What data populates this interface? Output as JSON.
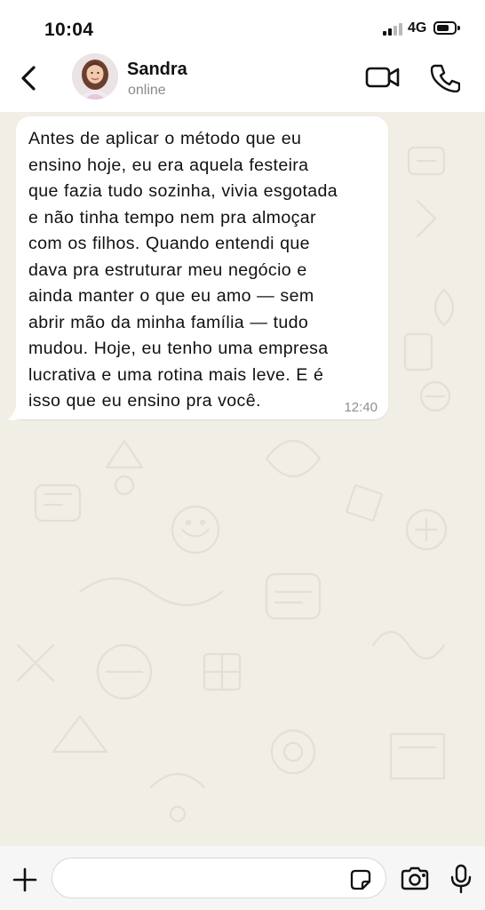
{
  "status_bar": {
    "time": "10:04",
    "network": "4G",
    "signal_icon": "signal-bars-icon",
    "battery_icon": "battery-icon"
  },
  "header": {
    "back_icon": "chevron-left-icon",
    "contact_name": "Sandra",
    "contact_status": "online",
    "video_call_icon": "video-camera-icon",
    "voice_call_icon": "phone-icon"
  },
  "messages": [
    {
      "direction": "incoming",
      "text": "Antes de aplicar o método que eu\nensino hoje, eu era aquela festeira\nque fazia tudo sozinha, vivia esgotada\ne não tinha tempo nem pra almoçar\ncom os filhos. Quando entendi que\ndava pra estruturar meu negócio e\nainda manter o que eu amo — sem\nabrir mão da minha família — tudo\nmudou. Hoje, eu tenho uma empresa\nlucrativa e uma rotina mais leve. E é\nisso que eu ensino pra você.",
      "time": "12:40"
    }
  ],
  "input_bar": {
    "text_value": "",
    "plus_icon": "plus-icon",
    "sticker_icon": "sticker-icon",
    "camera_icon": "camera-icon",
    "mic_icon": "microphone-icon"
  },
  "colors": {
    "chat_background": "#f1eee6",
    "bubble_incoming": "#ffffff",
    "header_background": "#ffffff",
    "secondary_text": "#8a8a8a"
  }
}
